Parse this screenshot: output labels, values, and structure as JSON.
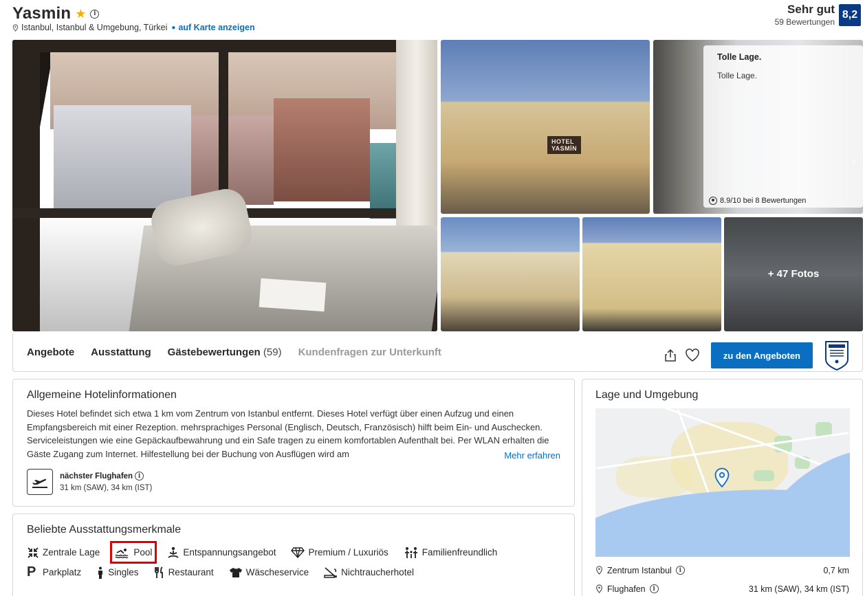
{
  "hotel": {
    "name": "Yasmin",
    "location": "Istanbul, Istanbul & Umgebung, Türkei",
    "map_link": "auf Karte anzeigen"
  },
  "rating": {
    "word": "Sehr gut",
    "count": "59 Bewertungen",
    "score": "8,2"
  },
  "gallery": {
    "sign_line1": "HOTEL",
    "sign_line2": "YASMİN",
    "more_photos": "+ 47 Fotos",
    "review_card": {
      "title": "Tolle Lage.",
      "body": "Tolle Lage.",
      "footer": "8.9/10 bei 8 Bewertungen"
    }
  },
  "nav": {
    "items": [
      {
        "label": "Angebote"
      },
      {
        "label": "Ausstattung"
      },
      {
        "label": "Gästebewertungen",
        "count": "(59)"
      },
      {
        "label": "Kundenfragen zur Unterkunft"
      }
    ],
    "cta": "zu den Angeboten"
  },
  "info": {
    "title": "Allgemeine Hotelinformationen",
    "text": "Dieses Hotel befindet sich etwa 1 km vom Zentrum von Istanbul entfernt. Dieses Hotel verfügt über einen Aufzug und einen Empfangsbereich mit einer Rezeption. mehrsprachiges Personal (Englisch, Deutsch, Französisch) hilft beim Ein- und Auschecken. Serviceleistungen wie eine Gepäckaufbewahrung und ein Safe tragen zu einem komfortablen Aufenthalt bei. Per WLAN erhalten die Gäste Zugang zum Internet. Hilfestellung bei der Buchung von Ausflügen wird am",
    "more": "Mehr erfahren",
    "airport_label": "nächster Flughafen",
    "airport_value": "31 km (SAW), 34 km (IST)"
  },
  "features": {
    "title": "Beliebte Ausstattungsmerkmale",
    "row1": [
      "Zentrale Lage",
      "Pool",
      "Entspannungsangebot",
      "Premium / Luxuriös",
      "Familienfreundlich"
    ],
    "row2": [
      "Parkplatz",
      "Singles",
      "Restaurant",
      "Wäscheservice",
      "Nichtraucherhotel"
    ]
  },
  "location": {
    "title": "Lage und Umgebung",
    "rows": [
      {
        "label": "Zentrum Istanbul",
        "value": "0,7 km"
      },
      {
        "label": "Flughafen",
        "value": "31 km (SAW), 34 km (IST)"
      }
    ]
  },
  "colors": {
    "accent": "#0a6ec1",
    "badge": "#0b3a84",
    "star": "#f0b400",
    "highlight": "#e00000"
  }
}
